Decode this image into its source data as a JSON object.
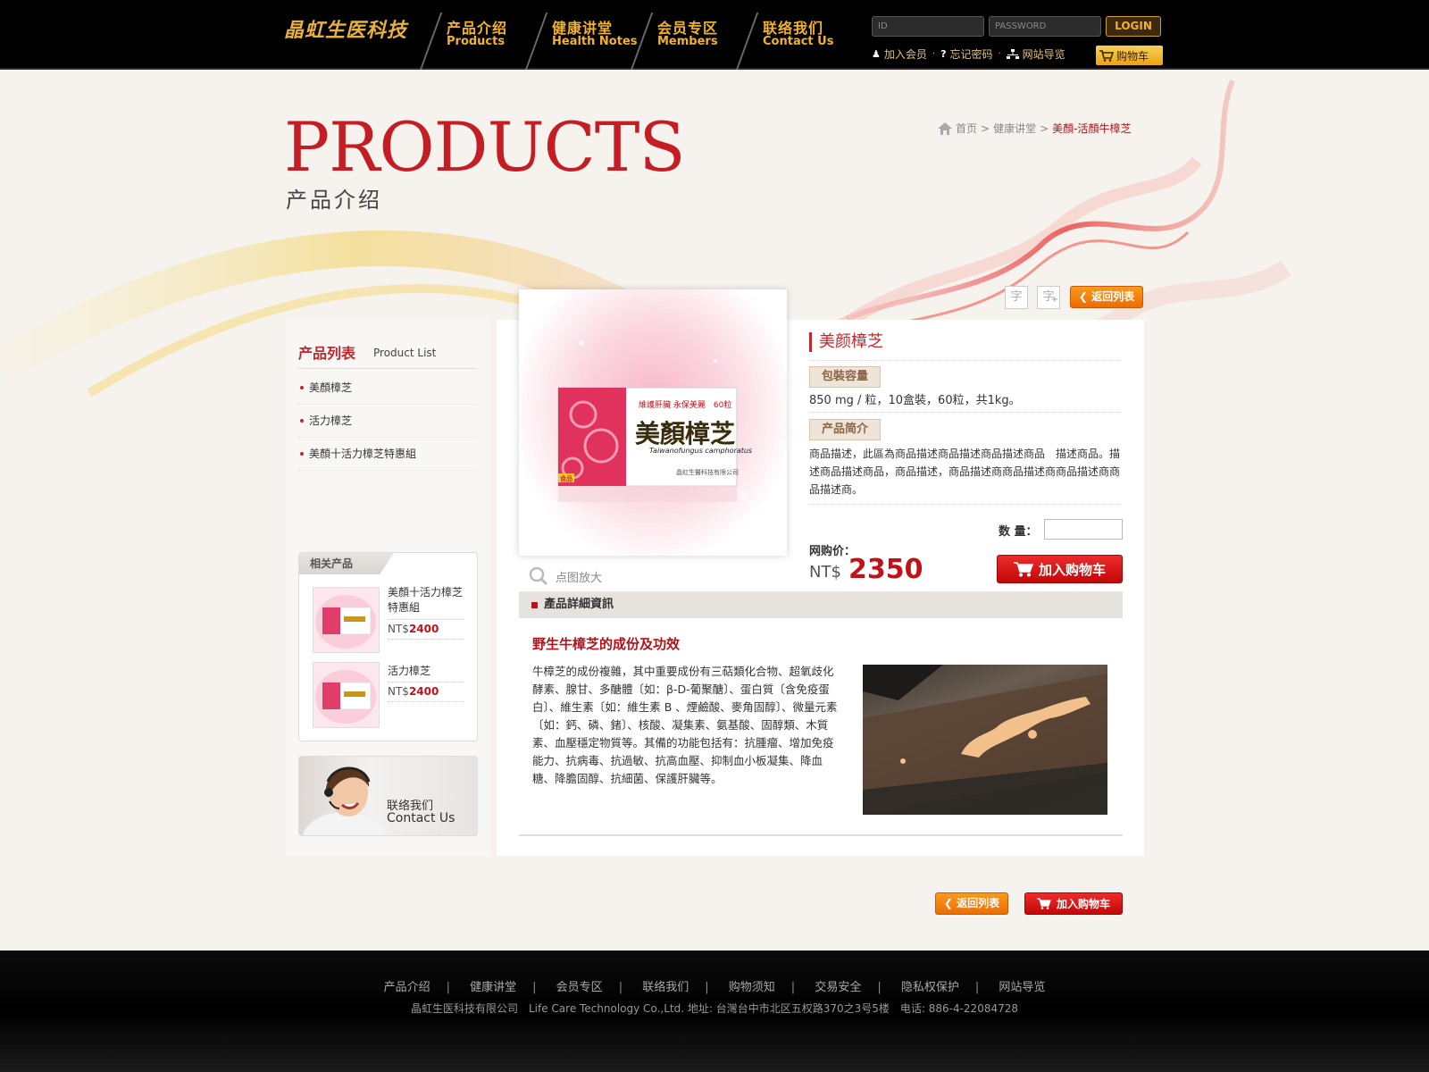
{
  "header": {
    "logo": "晶虹生医科技",
    "nav": [
      {
        "cn": "产品介绍",
        "en": "Products"
      },
      {
        "cn": "健康讲堂",
        "en": "Health Notes"
      },
      {
        "cn": "会员专区",
        "en": "Members"
      },
      {
        "cn": "联络我们",
        "en": "Contact Us"
      }
    ],
    "id_placeholder": "ID",
    "password_placeholder": "PASSWORD",
    "login_label": "LOGIN",
    "links": [
      "加入会员",
      "忘记密码",
      "网站导览"
    ],
    "cart_label": "购物车"
  },
  "hero": {
    "title": "PRODUCTS",
    "subtitle": "产品介绍"
  },
  "breadcrumb": {
    "items": [
      "首页",
      "健康讲堂",
      "美顏-活顏牛樟芝"
    ],
    "separator": ">"
  },
  "sidebar": {
    "title": "产品列表",
    "title_en": "Product List",
    "items": [
      "美顏樟芝",
      "活力樟芝",
      "美顏十活力樟芝特惠組"
    ],
    "related_title": "相关产品",
    "related": [
      {
        "name": "美顏十活力樟芝特惠組",
        "currency": "NT$",
        "price": "2400"
      },
      {
        "name": "活力樟芝",
        "currency": "NT$",
        "price": "2400"
      }
    ],
    "contact_cn": "联络我们",
    "contact_en": "Contact Us"
  },
  "product": {
    "name": "美颜樟芝",
    "box_text_top": "維護肝臟 永保美麗",
    "box_text_count": "60粒",
    "box_title": "美顏樟芝",
    "box_latin": "Taiwanofungus camphoratus",
    "box_company": "晶虹生醫科技有限公司",
    "box_badge": "食品",
    "spec_tag": "包裝容量",
    "spec": "850 mg / 粒，10盒裝，60粒，共1kg。",
    "intro_tag": "产品简介",
    "description": "商品描述，此區為商品描述商品描述商品描述商品　描述商品。描述商品描述商品，商品描述，商品描述商商品描述商商品描述商商品描述商。",
    "zoom_label": "点图放大",
    "qty_label": "数 量：",
    "price_label": "网购价：",
    "currency": "NT$",
    "price": "2350",
    "add_cart_label": "加入购物车",
    "back_list_label": "返回列表",
    "font_small": "字",
    "font_large": "字"
  },
  "detail": {
    "bar_title": "產品詳細資訊",
    "section_title": "野生牛樟芝的成份及功效",
    "body": "牛樟芝的成份複雜，其中重要成份有三萜類化合物、超氧歧化酵素、腺甘、多醣體〔如：β-D-葡聚醣〕、蛋白質〔含免疫蛋白〕、維生素〔如：維生素 B 、煙鹼酸、麥角固醇〕、微量元素〔如：鈣、磷、鍺〕、核酸、凝集素、氨基酸、固醇類、木質素、血壓穩定物質等。其備的功能包括有：抗腫瘤、增加免疫能力、抗病毒、抗過敏、抗高血壓、抑制血小板凝集、降血糖、降膽固醇、抗細菌、保護肝臟等。"
  },
  "bottom_buttons": {
    "back": "返回列表",
    "add_cart": "加入购物车"
  },
  "footer": {
    "links": [
      "产品介绍",
      "健康讲堂",
      "会员专区",
      "联络我们",
      "购物须知",
      "交易安全",
      "隐私权保护",
      "网站导览"
    ],
    "copyright": "晶虹生医科技有限公司　Life Care Technology Co.,Ltd. 地址: 台灣台中市北区五权路370之3号5楼　电话: 886-4-22084728"
  },
  "colors": {
    "accent_red": "#c1272d",
    "nav_gold": "#f2b32b",
    "orange_button": "#ec6c04"
  }
}
